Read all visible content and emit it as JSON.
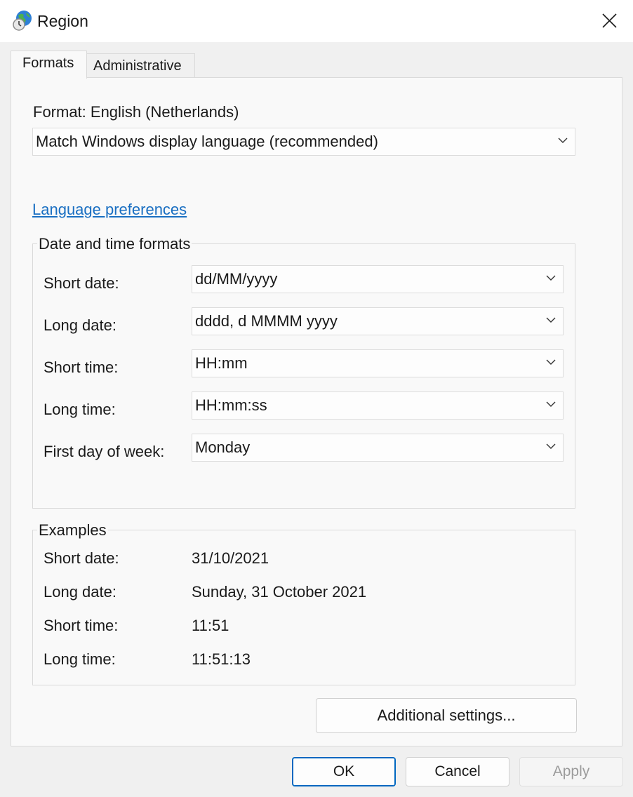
{
  "window": {
    "title": "Region"
  },
  "tabs": [
    {
      "label": "Formats",
      "active": true
    },
    {
      "label": "Administrative",
      "active": false
    }
  ],
  "format": {
    "label": "Format: English (Netherlands)",
    "selected": "Match Windows display language (recommended)"
  },
  "language_preferences_link": "Language preferences",
  "date_time_formats": {
    "title": "Date and time formats",
    "short_date": {
      "label": "Short date:",
      "value": "dd/MM/yyyy"
    },
    "long_date": {
      "label": "Long date:",
      "value": "dddd, d MMMM yyyy"
    },
    "short_time": {
      "label": "Short time:",
      "value": "HH:mm"
    },
    "long_time": {
      "label": "Long time:",
      "value": "HH:mm:ss"
    },
    "first_day": {
      "label": "First day of week:",
      "value": "Monday"
    }
  },
  "examples": {
    "title": "Examples",
    "short_date": {
      "label": "Short date:",
      "value": "31/10/2021"
    },
    "long_date": {
      "label": "Long date:",
      "value": "Sunday, 31 October 2021"
    },
    "short_time": {
      "label": "Short time:",
      "value": "11:51"
    },
    "long_time": {
      "label": "Long time:",
      "value": "11:51:13"
    }
  },
  "buttons": {
    "additional_settings": "Additional settings...",
    "ok": "OK",
    "cancel": "Cancel",
    "apply": "Apply"
  },
  "icons": {
    "app": "globe-clock-icon",
    "close": "close-icon",
    "dropdown": "chevron-down-icon"
  },
  "colors": {
    "link": "#1a6fc2",
    "default_button_border": "#0067c0",
    "disabled_text": "#9b9b9b"
  }
}
